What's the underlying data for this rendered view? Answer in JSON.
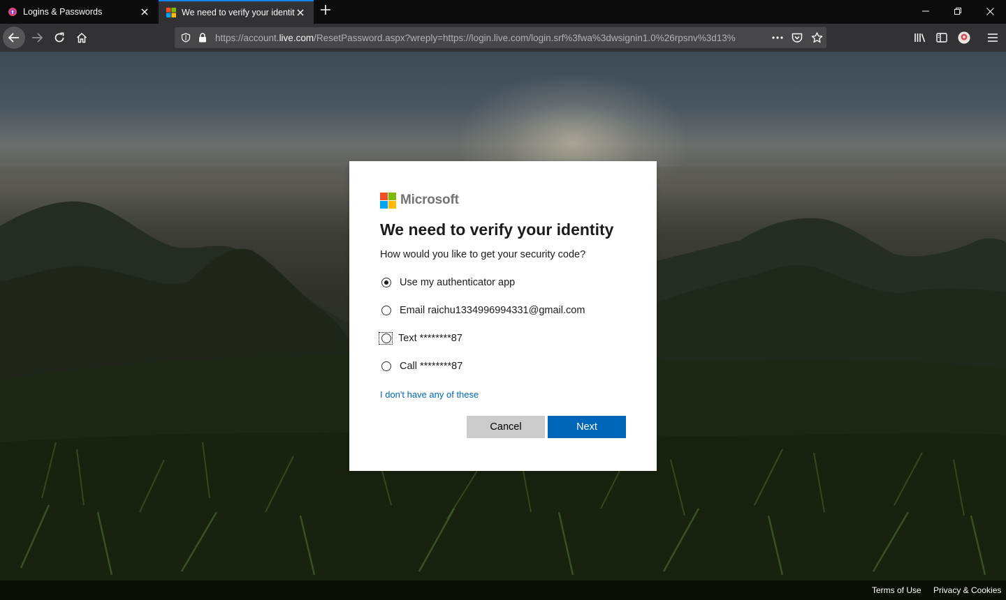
{
  "browser": {
    "tabs": [
      {
        "title": "Logins & Passwords",
        "icon": "lockwise-icon",
        "active": false
      },
      {
        "title": "We need to verify your identity",
        "icon": "microsoft-favicon",
        "active": true
      }
    ],
    "url": {
      "prefix": "https://account.",
      "domain": "live.com",
      "rest": "/ResetPassword.aspx?wreply=https://login.live.com/login.srf%3fwa%3dwsignin1.0%26rpsnv%3d13%"
    }
  },
  "dialog": {
    "brand": "Microsoft",
    "title": "We need to verify your identity",
    "subtitle": "How would you like to get your security code?",
    "options": [
      {
        "label": "Use my authenticator app",
        "checked": true
      },
      {
        "label": "Email raichu1334996994331@gmail.com",
        "checked": false
      },
      {
        "label": "Text ********87",
        "checked": false,
        "focused": true
      },
      {
        "label": "Call ********87",
        "checked": false
      }
    ],
    "link": "I don't have any of these",
    "cancel_label": "Cancel",
    "next_label": "Next"
  },
  "footer": {
    "terms": "Terms of Use",
    "privacy": "Privacy & Cookies"
  },
  "colors": {
    "accent": "#0067b8",
    "ms_red": "#f25022",
    "ms_green": "#7fba00",
    "ms_blue": "#00a4ef",
    "ms_yellow": "#ffb900",
    "tab_highlight": "#0a84ff"
  }
}
